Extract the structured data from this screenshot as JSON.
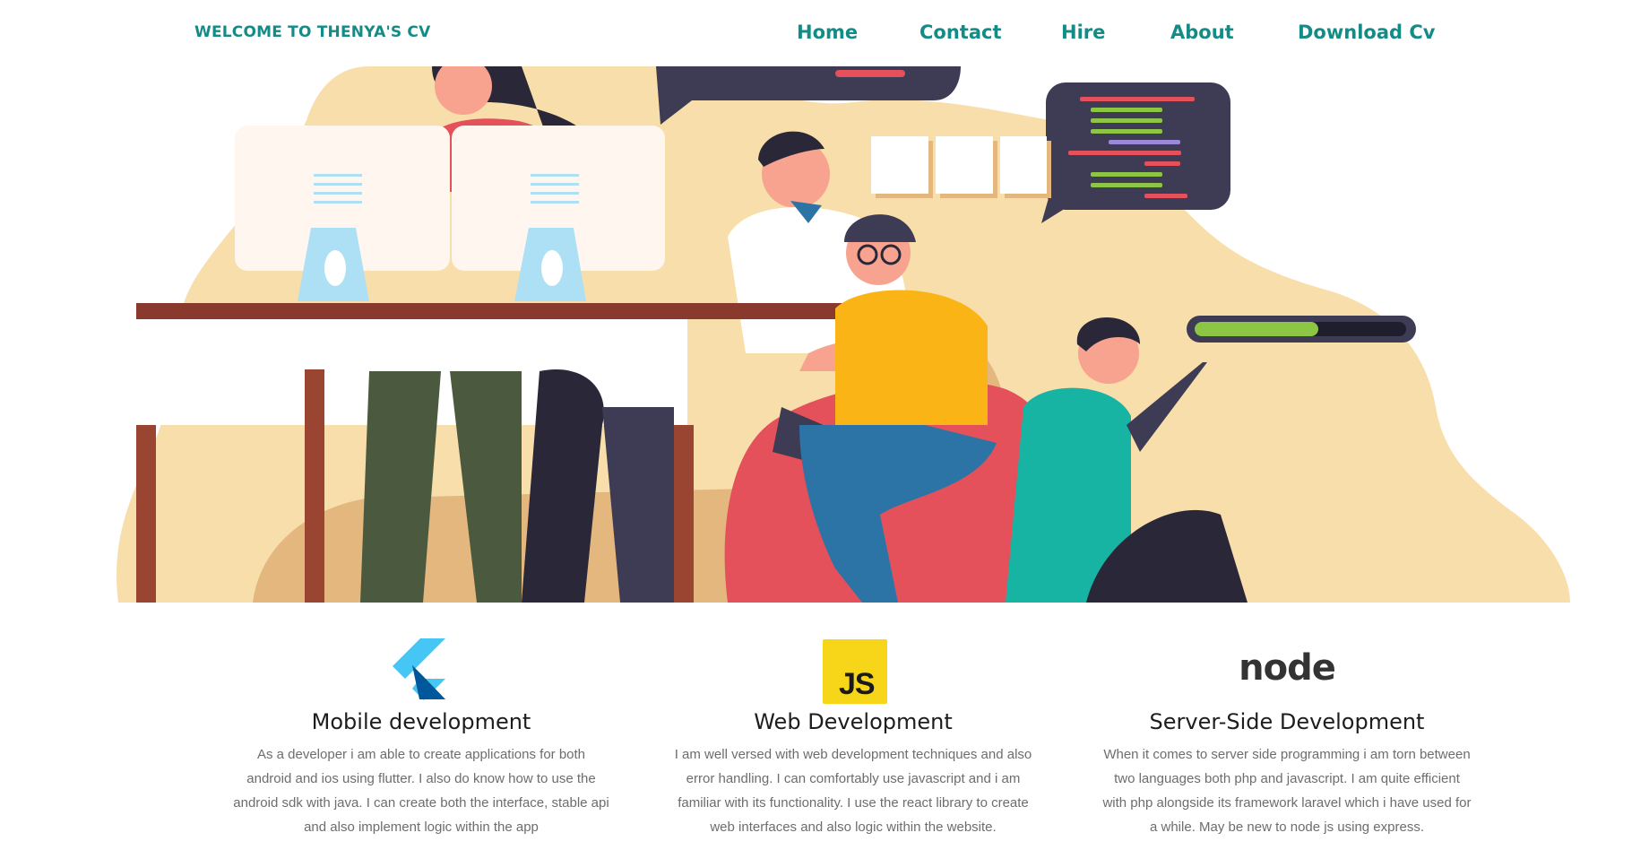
{
  "nav": {
    "brand": "WELCOME TO THENYA'S CV",
    "links": [
      "Home",
      "Contact",
      "Hire",
      "About",
      "Download Cv"
    ]
  },
  "colors": {
    "accent": "#138c87",
    "hero_bg": "#f8deaa",
    "js_yellow": "#f7d518",
    "flutter_blue": "#45c6f5",
    "node_green": "#5fa04e"
  },
  "features": [
    {
      "icon": "flutter-logo",
      "title": "Mobile development",
      "lines": [
        "As a developer i am able to create applications for both",
        "android and ios using flutter. I also do know how to use the",
        "android sdk with java. I can create both the interface, stable api",
        "and also implement logic within the app"
      ]
    },
    {
      "icon": "javascript-logo",
      "logo_text": "JS",
      "title": "Web Development",
      "lines": [
        "I am well versed with web development techniques and also",
        "error handling. I can comfortably use javascript and i am",
        "familiar with its functionality. I use the react library to create",
        "web interfaces and also logic within the website."
      ]
    },
    {
      "icon": "nodejs-logo",
      "logo_text": "node",
      "title": "Server-Side Development",
      "lines": [
        "When it comes to server side programming i am torn between",
        "two languages both php and javascript. I am quite efficient",
        "with php alongside its framework laravel which i have used for",
        "a while. May be new to node js using express."
      ]
    }
  ]
}
